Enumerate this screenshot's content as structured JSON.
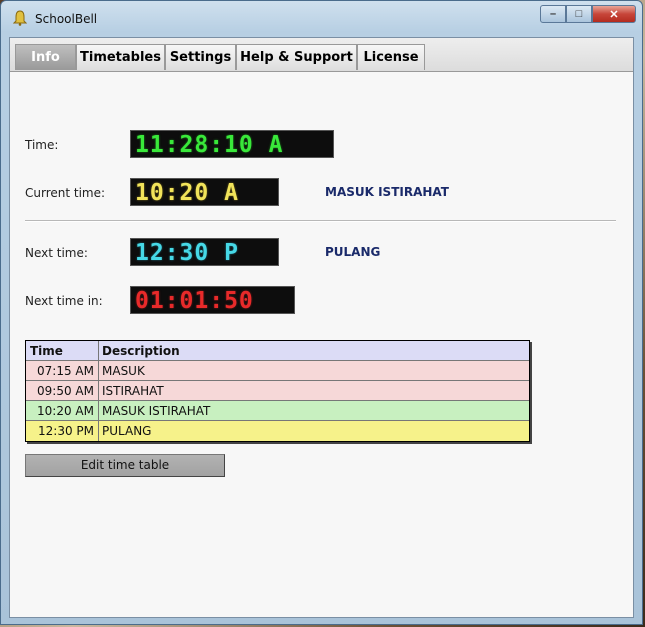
{
  "window": {
    "title": "SchoolBell",
    "icon": "bell-icon"
  },
  "tabs": [
    {
      "label": "Info",
      "active": true
    },
    {
      "label": "Timetables",
      "active": false
    },
    {
      "label": "Settings",
      "active": false
    },
    {
      "label": "Help & Support",
      "active": false
    },
    {
      "label": "License",
      "active": false
    }
  ],
  "info": {
    "time_label": "Time:",
    "time_value": "11:28:10 A",
    "current_label": "Current time:",
    "current_value": "10:20 A",
    "current_desc": "MASUK ISTIRAHAT",
    "next_label": "Next time:",
    "next_value": "12:30 P",
    "next_desc": "PULANG",
    "next_in_label": "Next time in:",
    "next_in_value": "01:01:50"
  },
  "table": {
    "headers": {
      "time": "Time",
      "description": "Description"
    },
    "rows": [
      {
        "time": "07:15 AM",
        "description": "MASUK",
        "color": "#f6d8d8"
      },
      {
        "time": "09:50 AM",
        "description": "ISTIRAHAT",
        "color": "#f6d8d8"
      },
      {
        "time": "10:20 AM",
        "description": "MASUK ISTIRAHAT",
        "color": "#c8f0c0"
      },
      {
        "time": "12:30 PM",
        "description": "PULANG",
        "color": "#f6f28a"
      }
    ]
  },
  "edit_button": "Edit time table",
  "colors": {
    "lcd_green": "#39e83a",
    "lcd_yellow": "#f1e35a",
    "lcd_cyan": "#46d8e6",
    "lcd_red": "#e82a2a",
    "desc_text": "#1a2a6a"
  }
}
